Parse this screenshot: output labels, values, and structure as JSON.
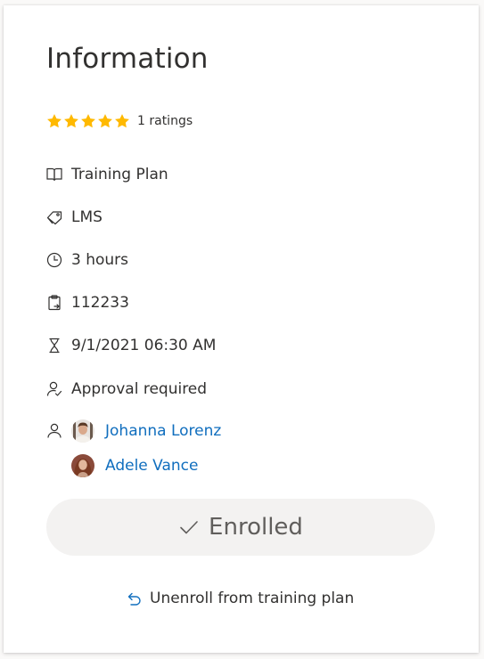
{
  "card": {
    "title": "Information",
    "rating": {
      "stars": 5,
      "filled": 5,
      "text": "1 ratings",
      "star_color": "#ffb900"
    },
    "details": [
      {
        "icon": "book-icon",
        "text": "Training Plan"
      },
      {
        "icon": "tag-icon",
        "text": "LMS"
      },
      {
        "icon": "clock-icon",
        "text": "3 hours"
      },
      {
        "icon": "clipboard-icon",
        "text": "112233"
      },
      {
        "icon": "hourglass-icon",
        "text": "9/1/2021 06:30 AM"
      },
      {
        "icon": "person-check-icon",
        "text": "Approval required"
      }
    ],
    "people_icon": "person-icon",
    "people": [
      {
        "name": "Johanna Lorenz"
      },
      {
        "name": "Adele Vance"
      }
    ],
    "link_color": "#106ebe",
    "enrolled_button": {
      "label": "Enrolled",
      "icon": "checkmark-icon"
    },
    "unenroll": {
      "label": "Unenroll from training plan",
      "icon": "undo-icon",
      "icon_color": "#106ebe"
    }
  }
}
